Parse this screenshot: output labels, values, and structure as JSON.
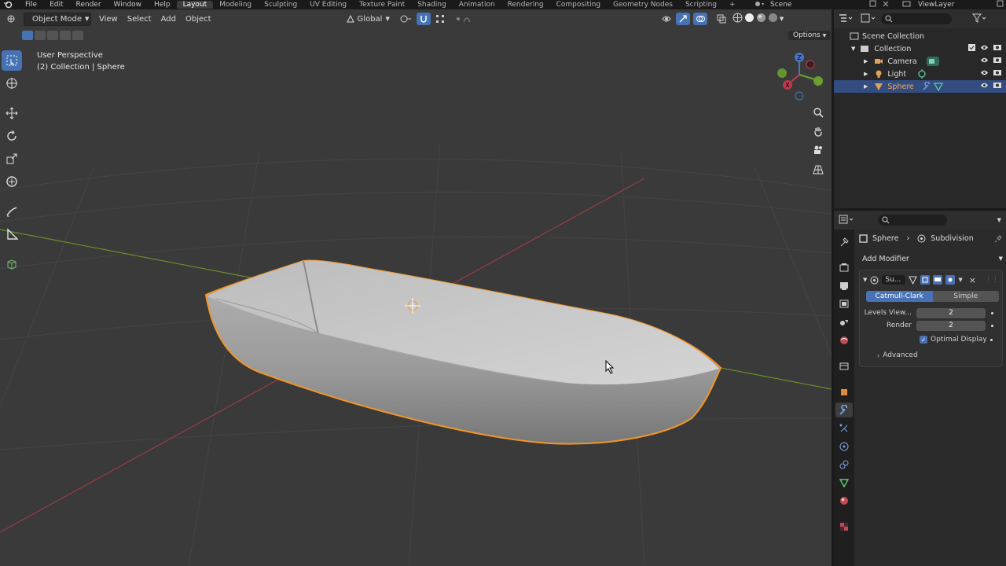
{
  "topbar": {
    "menus": [
      "File",
      "Edit",
      "Render",
      "Window",
      "Help"
    ],
    "workspaces": [
      "Layout",
      "Modeling",
      "Sculpting",
      "UV Editing",
      "Texture Paint",
      "Shading",
      "Animation",
      "Rendering",
      "Compositing",
      "Geometry Nodes",
      "Scripting"
    ],
    "active_workspace": "Layout",
    "add_tab_label": "+",
    "scene_name": "Scene",
    "view_layer_name": "ViewLayer"
  },
  "viewport": {
    "mode": "Object Mode",
    "menus": [
      "View",
      "Select",
      "Add",
      "Object"
    ],
    "transform_orientation": "Global",
    "options_label": "Options",
    "perspective_label": "User Perspective",
    "collection_info": "(2) Collection | Sphere",
    "gizmo_axes": [
      "Z",
      "Y",
      "X"
    ],
    "colors": {
      "background": "#3a3a3a",
      "grid": "#484848",
      "x_axis": "#9b3a45",
      "y_axis": "#6b8f2a",
      "selection_outline": "#f0962a",
      "active_tool": "#4772b3"
    }
  },
  "tools": [
    "select-box",
    "cursor",
    "move",
    "rotate",
    "scale",
    "transform",
    "annotate",
    "measure",
    "add-cube"
  ],
  "outliner": {
    "root": "Scene Collection",
    "collection": "Collection",
    "items": [
      {
        "name": "Camera",
        "icon": "camera-icon",
        "selected": false
      },
      {
        "name": "Light",
        "icon": "light-icon",
        "selected": false
      },
      {
        "name": "Sphere",
        "icon": "mesh-icon",
        "selected": true
      }
    ]
  },
  "properties": {
    "object_name": "Sphere",
    "modifier_crumb": "Subdivision",
    "add_modifier_label": "Add Modifier",
    "modifier": {
      "short_name": "Su...",
      "algorithm_options": [
        "Catmull-Clark",
        "Simple"
      ],
      "selected_algorithm": "Catmull-Clark",
      "fields": [
        {
          "label": "Levels View...",
          "value": "2"
        },
        {
          "label": "Render",
          "value": "2"
        }
      ],
      "optimal_display_label": "Optimal Display",
      "optimal_display_checked": true,
      "advanced_label": "Advanced"
    }
  }
}
